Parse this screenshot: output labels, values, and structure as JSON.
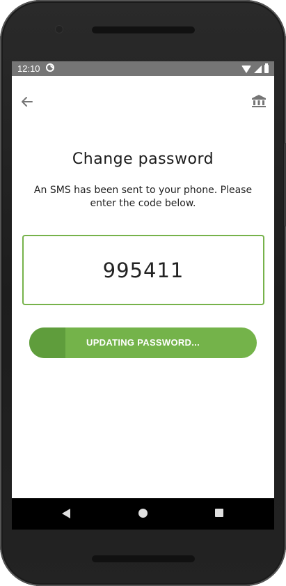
{
  "status_bar": {
    "time": "12:10",
    "icons": [
      "app-notification-icon",
      "wifi-icon",
      "signal-icon",
      "battery-icon"
    ]
  },
  "app_bar": {
    "back_icon": "arrow-left-icon",
    "right_icon": "bank-icon"
  },
  "page": {
    "title": "Change password",
    "subtitle": "An SMS has been sent to your phone. Please enter the code below."
  },
  "code_field": {
    "value": "995411",
    "border_color": "#76b24a"
  },
  "submit_button": {
    "label": "UPDATING PASSWORD...",
    "progress": 0.16,
    "color": "#74b34a",
    "progress_color": "#5f9d3c"
  },
  "nav_bar": {
    "back_icon": "triangle-back-icon",
    "home_icon": "circle-home-icon",
    "recents_icon": "square-recents-icon"
  }
}
